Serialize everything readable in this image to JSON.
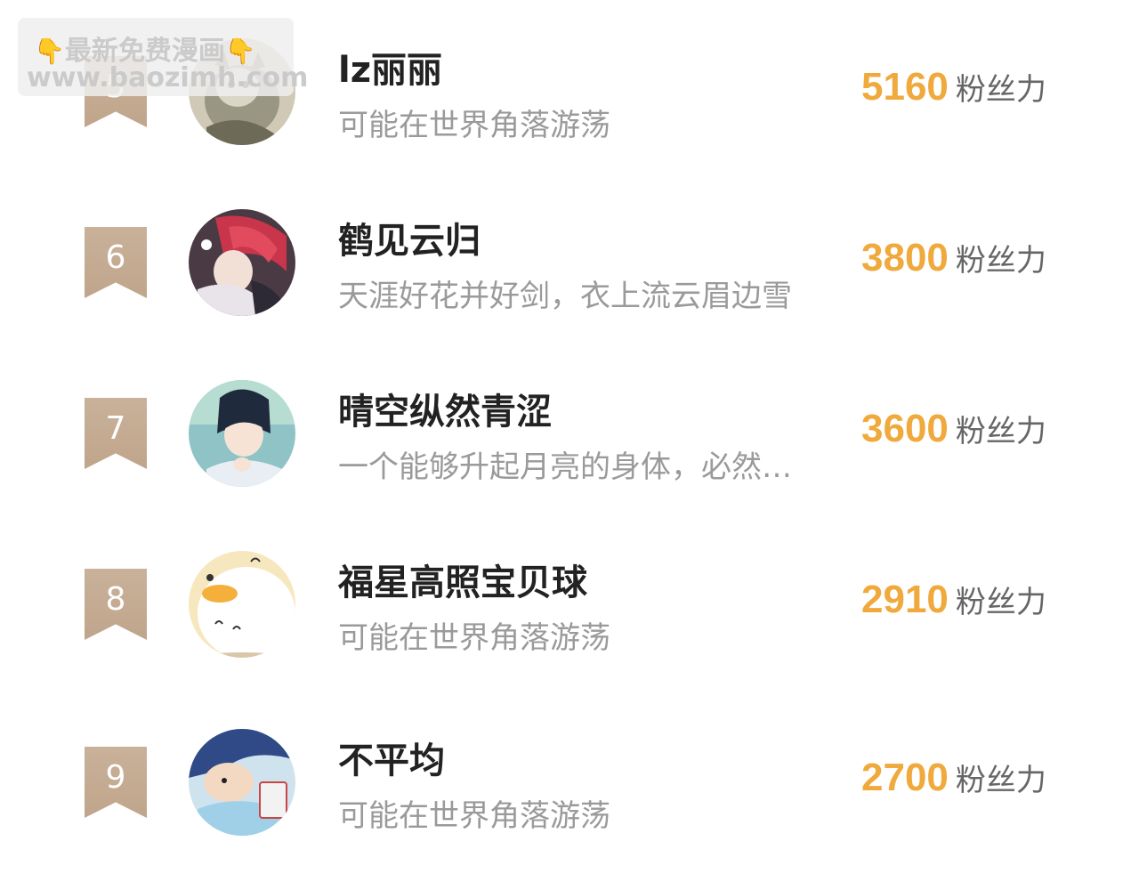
{
  "watermark": {
    "line1": "最新免费漫画",
    "line2": "www.baozimh.com",
    "hand_glyph": "👇"
  },
  "score_unit": "粉丝力",
  "rows": [
    {
      "rank": "5",
      "name": "lz丽丽",
      "desc": "可能在世界角落游荡",
      "score": "5160",
      "avatar": "grey-cat-avatar"
    },
    {
      "rank": "6",
      "name": "鹤见云归",
      "desc": "天涯好花并好剑，衣上流云眉边雪",
      "score": "3800",
      "avatar": "red-hair-character-avatar"
    },
    {
      "rank": "7",
      "name": "晴空纵然青涩",
      "desc": "一个能够升起月亮的身体，必然…",
      "score": "3600",
      "avatar": "dark-hair-boy-avatar"
    },
    {
      "rank": "8",
      "name": "福星高照宝贝球",
      "desc": "可能在世界角落游荡",
      "score": "2910",
      "avatar": "white-duck-avatar"
    },
    {
      "rank": "9",
      "name": "不平均",
      "desc": "可能在世界角落游荡",
      "score": "2700",
      "avatar": "cartoon-boy-avatar"
    }
  ],
  "colors": {
    "rank_badge": "#c4aa90",
    "score": "#f0a93c",
    "name": "#222222",
    "desc": "#9a9a9a"
  }
}
